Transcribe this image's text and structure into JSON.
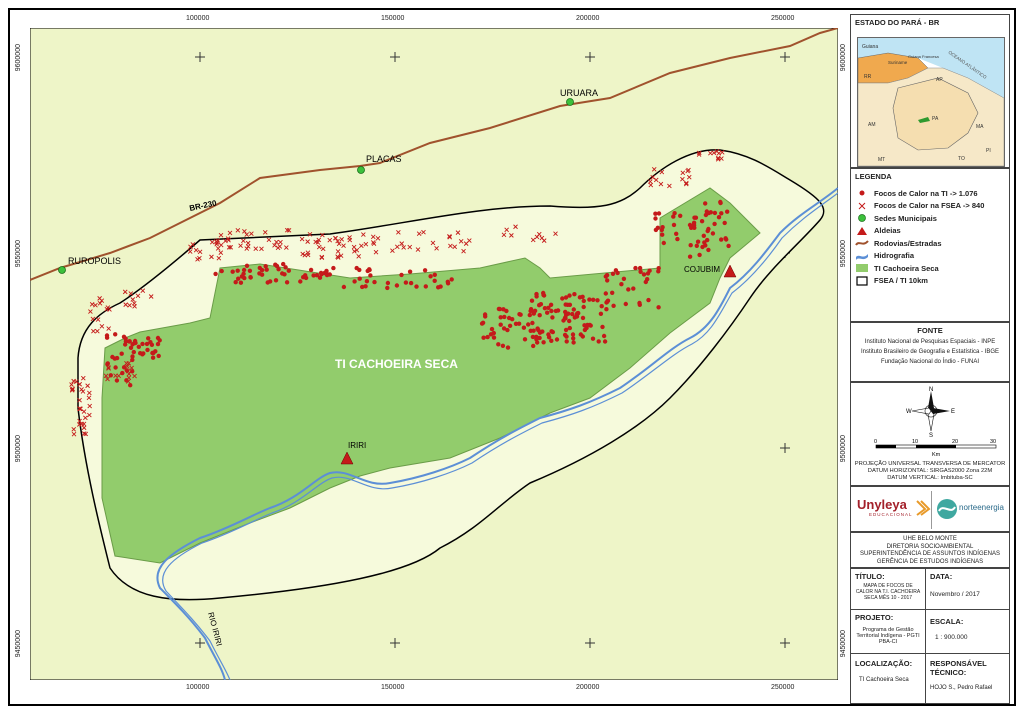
{
  "map": {
    "x_ticks": [
      "100000",
      "150000",
      "200000",
      "250000"
    ],
    "y_ticks_left": [
      "9600000",
      "9550000",
      "9500000",
      "9450000"
    ],
    "y_ticks_right": [
      "9600000",
      "9550000",
      "9500000",
      "9450000"
    ],
    "labels": {
      "uruara": "URUARA",
      "placas": "PLACAS",
      "ruropolis": "RUROPOLIS",
      "br230": "BR-230",
      "ti": "TI CACHOEIRA SECA",
      "cojubim": "COJUBIM",
      "iriri": "IRIRI",
      "rio_iriri": "RIO IRIRI"
    },
    "colors": {
      "background": "#eef5c8",
      "buffer": "#f4f9d6",
      "ti_fill": "#92cc6c",
      "road": "#a0522d",
      "river": "#5c8fd6",
      "hotspot": "#c41a1a"
    }
  },
  "inset": {
    "title": "ESTADO DO PARÁ - BR",
    "labels": [
      "Guiana",
      "Suriname",
      "Guiana Francesa",
      "OCEANO ATLÂNTICO",
      "RR",
      "AP",
      "AM",
      "PA",
      "MA",
      "MT",
      "PI",
      "TO"
    ]
  },
  "legend": {
    "title": "LEGENDA",
    "items": [
      {
        "label": "Focos de Calor na TI -> 1.076",
        "icon": "red-dot-icon"
      },
      {
        "label": "Focos de Calor na FSEA -> 840",
        "icon": "red-x-icon"
      },
      {
        "label": "Sedes Municipais",
        "icon": "green-dot-icon"
      },
      {
        "label": "Aldeias",
        "icon": "red-triangle-icon"
      },
      {
        "label": "Rodovias/Estradas",
        "icon": "road-line-icon"
      },
      {
        "label": "Hidrografia",
        "icon": "river-icon"
      },
      {
        "label": "TI Cachoeira Seca",
        "icon": "green-fill-icon"
      },
      {
        "label": "FSEA / TI 10km",
        "icon": "outline-icon"
      }
    ]
  },
  "fonte": {
    "title": "FONTE",
    "lines": [
      "Instituto Nacional de Pesquisas Espaciais - INPE",
      "Instituto Brasileiro de Geografia e Estatística - IBGE",
      "Fundação Nacional do Índio - FUNAI"
    ]
  },
  "compass": {
    "n": "N",
    "s": "S",
    "e": "E",
    "w": "W"
  },
  "scale": {
    "ticks": [
      "0",
      "10",
      "20",
      "30"
    ],
    "unit": "Km"
  },
  "projection": [
    "PROJEÇÃO UNIVERSAL TRANSVERSA DE MERCATOR",
    "DATUM HORIZONTAL: SIRGAS2000 Zona 22M",
    "DATUM VERTICAL: Imbituba-SC"
  ],
  "logos": {
    "unyleya": "Unyleya",
    "unyleya_sub": "EDUCACIONAL",
    "norte": "norteenergia"
  },
  "org": [
    "UHE BELO MONTE",
    "DIRETORIA SOCIOAMBIENTAL",
    "SUPERINTENDÊNCIA DE ASSUNTOS INDÍGENAS",
    "GERÊNCIA DE ESTUDOS INDÍGENAS"
  ],
  "titulo": {
    "label": "TÍTULO:",
    "value": "MAPA DE FOCOS DE CALOR NA T.I. CACHOEIRA SECA MÊS 10 - 2017"
  },
  "data": {
    "label": "DATA:",
    "value": "Novembro / 2017"
  },
  "projeto": {
    "label": "PROJETO:",
    "value": "Programa de Gestão Territorial Indígena - PGTI PBA-CI"
  },
  "escala": {
    "label": "ESCALA:",
    "value": "1 : 900.000"
  },
  "localizacao": {
    "label": "LOCALIZAÇÃO:",
    "value": "TI Cachoeira Seca"
  },
  "responsavel": {
    "label": "RESPONSÁVEL TÉCNICO:",
    "value": "HOJO S., Pedro Rafael"
  }
}
